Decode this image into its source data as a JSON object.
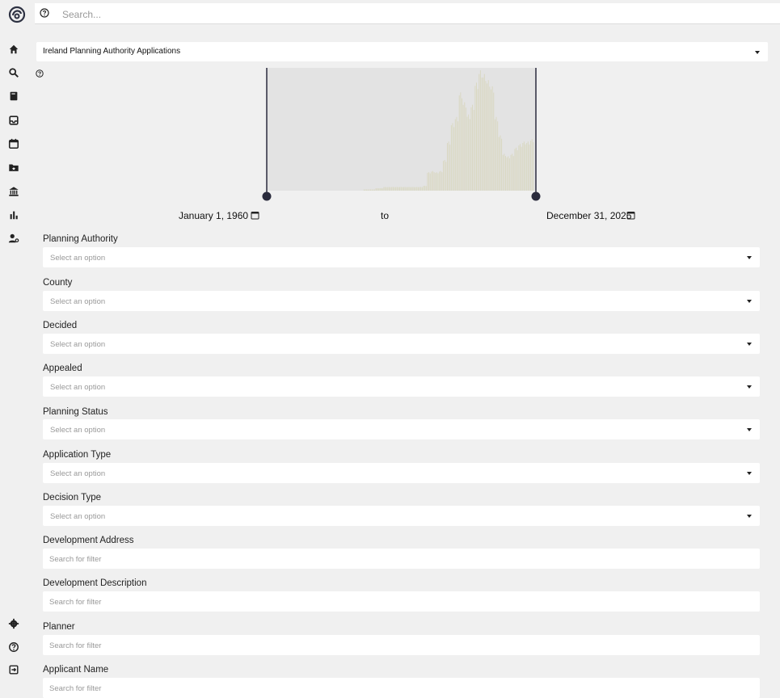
{
  "search": {
    "placeholder": "Search..."
  },
  "dataset": {
    "selected": "Ireland Planning Authority Applications"
  },
  "sidebar": {
    "icons": [
      "home-icon",
      "search-icon",
      "book-icon",
      "inbox-icon",
      "calendar-icon",
      "folder-star-icon",
      "bank-icon",
      "bar-chart-icon",
      "user-settings-icon",
      "gear-icon",
      "help-icon",
      "logout-icon"
    ]
  },
  "date_range": {
    "start": "January 1, 1960",
    "separator": "to",
    "end": "December 31, 2026"
  },
  "chart_data": {
    "type": "bar",
    "x_range": [
      "1960",
      "2026"
    ],
    "ylim": [
      0,
      100
    ],
    "x": [
      1960,
      1961,
      1962,
      1963,
      1964,
      1965,
      1966,
      1967,
      1968,
      1969,
      1970,
      1971,
      1972,
      1973,
      1974,
      1975,
      1976,
      1977,
      1978,
      1979,
      1980,
      1981,
      1982,
      1983,
      1984,
      1985,
      1986,
      1987,
      1988,
      1989,
      1990,
      1991,
      1992,
      1993,
      1994,
      1995,
      1996,
      1997,
      1998,
      1999,
      2000,
      2001,
      2002,
      2003,
      2004,
      2005,
      2006,
      2007,
      2008,
      2009,
      2010,
      2011,
      2012,
      2013,
      2014,
      2015,
      2016,
      2017,
      2018,
      2019,
      2020,
      2021,
      2022,
      2023,
      2024,
      2025,
      2026
    ],
    "values": [
      0,
      0,
      0,
      0,
      0,
      0,
      0,
      0,
      0,
      0,
      0,
      0,
      0,
      0,
      0,
      0,
      0,
      0,
      0,
      0,
      0,
      0,
      0,
      0,
      1,
      1,
      1,
      2,
      2,
      3,
      3,
      3,
      3,
      3,
      3,
      3,
      3,
      3,
      3,
      4,
      15,
      16,
      15,
      16,
      25,
      40,
      55,
      60,
      80,
      72,
      62,
      70,
      88,
      98,
      95,
      90,
      85,
      60,
      45,
      30,
      28,
      30,
      35,
      38,
      40,
      40,
      42
    ],
    "grid": false
  },
  "filters": [
    {
      "label": "Planning Authority",
      "placeholder": "Select an option",
      "kind": "select"
    },
    {
      "label": "County",
      "placeholder": "Select an option",
      "kind": "select"
    },
    {
      "label": "Decided",
      "placeholder": "Select an option",
      "kind": "select"
    },
    {
      "label": "Appealed",
      "placeholder": "Select an option",
      "kind": "select"
    },
    {
      "label": "Planning Status",
      "placeholder": "Select an option",
      "kind": "select"
    },
    {
      "label": "Application Type",
      "placeholder": "Select an option",
      "kind": "select"
    },
    {
      "label": "Decision Type",
      "placeholder": "Select an option",
      "kind": "select"
    },
    {
      "label": "Development Address",
      "placeholder": "Search for filter",
      "kind": "search"
    },
    {
      "label": "Development Description",
      "placeholder": "Search for filter",
      "kind": "search"
    },
    {
      "label": "Planner",
      "placeholder": "Search for filter",
      "kind": "search"
    },
    {
      "label": "Applicant Name",
      "placeholder": "Search for filter",
      "kind": "search"
    }
  ],
  "colors": {
    "bar": "#d9d8c2",
    "chart_bg": "#e3e3e3",
    "handle": "#2a2b3d"
  }
}
